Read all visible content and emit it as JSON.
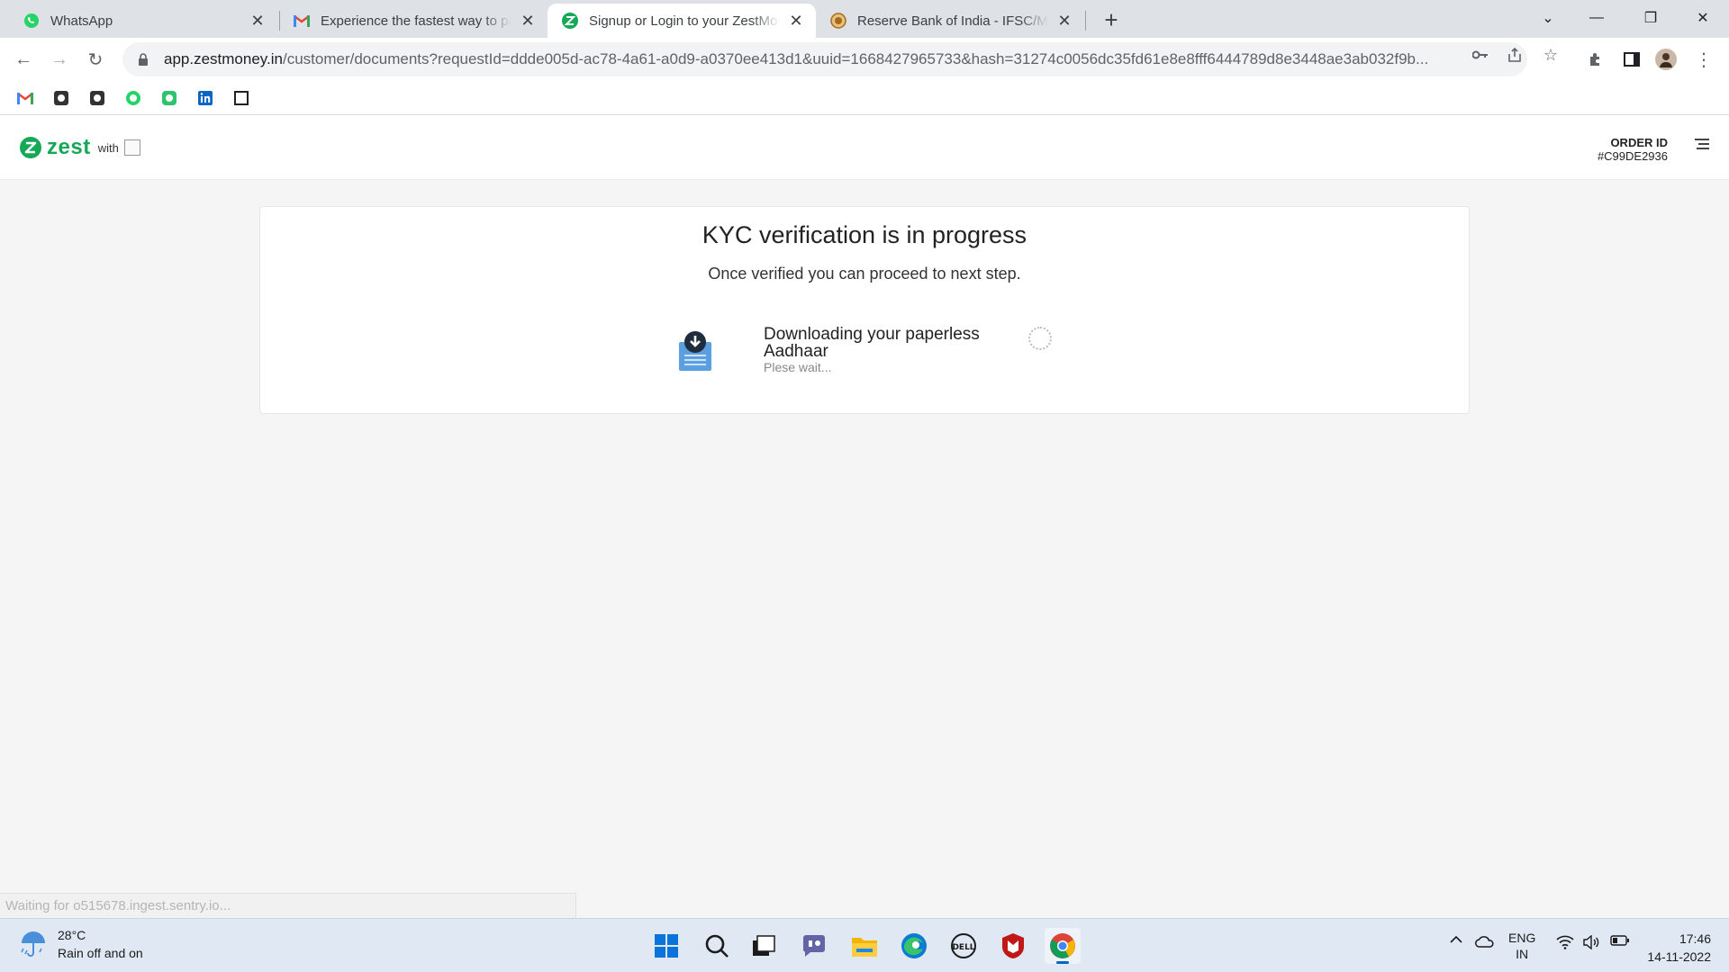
{
  "browser": {
    "tabs": [
      {
        "title": "WhatsApp",
        "icon": "whatsapp-icon",
        "active": false
      },
      {
        "title": "Experience the fastest way to pay",
        "icon": "gmail-icon",
        "active": false
      },
      {
        "title": "Signup or Login to your ZestMoney",
        "icon": "zest-icon",
        "active": true
      },
      {
        "title": "Reserve Bank of India - IFSC/MICR",
        "icon": "rbi-icon",
        "active": false
      }
    ],
    "url_host": "app.zestmoney.in",
    "url_rest": "/customer/documents?requestId=ddde005d-ac78-4a61-a0d9-a0370ee413d1&uuid=1668427965733&hash=31274c0056dc35fd61e8e8fff6444789d8e3448ae3ab032f9b...",
    "status_text": "Waiting for o515678.ingest.sentry.io..."
  },
  "app": {
    "brand": "zest",
    "with_label": "with",
    "order_label": "ORDER ID",
    "order_id": "#C99DE2936"
  },
  "kyc": {
    "title": "KYC verification is in progress",
    "subtitle": "Once verified you can proceed to next step.",
    "step_title": "Downloading your paperless Aadhaar",
    "step_subtitle": "Plese wait..."
  },
  "taskbar": {
    "temperature": "28°C",
    "weather": "Rain off and on",
    "lang_primary": "ENG",
    "lang_secondary": "IN",
    "time": "17:46",
    "date": "14-11-2022"
  },
  "colors": {
    "zest_green": "#14a857",
    "doc_blue": "#5a9fe0"
  }
}
